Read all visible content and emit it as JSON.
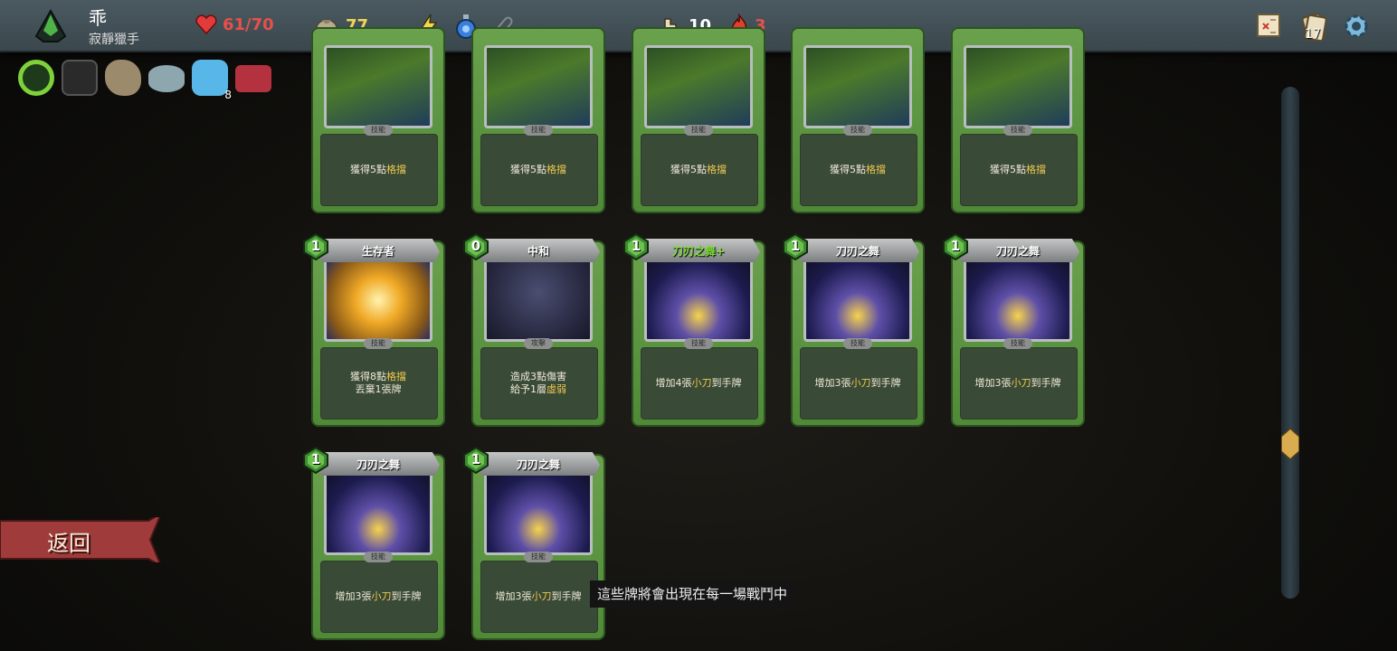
{
  "player": {
    "name": "乖",
    "class": "寂靜獵手"
  },
  "hp": {
    "current": 61,
    "max": 70,
    "text": "61/70"
  },
  "gold": "77",
  "floor": "10",
  "ascension": "3",
  "deck_count": "17",
  "relics": [
    {
      "icon": "ring-of-snake-icon"
    },
    {
      "icon": "dark-box-relic-icon"
    },
    {
      "icon": "pouch-relic-icon"
    },
    {
      "icon": "smooth-stone-relic-icon"
    },
    {
      "icon": "potion-bottle-relic-icon",
      "count": "8"
    },
    {
      "icon": "chest-relic-icon"
    }
  ],
  "cards_top": [
    {
      "desc_pre": "獲得5點",
      "desc_kw": "格擋",
      "type": "技能"
    },
    {
      "desc_pre": "獲得5點",
      "desc_kw": "格擋",
      "type": "技能"
    },
    {
      "desc_pre": "獲得5點",
      "desc_kw": "格擋",
      "type": "技能"
    },
    {
      "desc_pre": "獲得5點",
      "desc_kw": "格擋",
      "type": "技能"
    },
    {
      "desc_pre": "獲得5點",
      "desc_kw": "格擋",
      "type": "技能"
    }
  ],
  "cards": [
    {
      "cost": "1",
      "name": "生存者",
      "type": "技能",
      "line1_pre": "獲得8點",
      "line1_kw": "格擋",
      "line2": "丟棄1張牌"
    },
    {
      "cost": "0",
      "name": "中和",
      "type": "攻擊",
      "line1": "造成3點傷害",
      "line2_pre": "給予1層",
      "line2_kw": "虛弱"
    },
    {
      "cost": "1",
      "name": "刀刃之舞+",
      "type": "技能",
      "desc_pre": "增加4張",
      "desc_kw": "小刀",
      "desc_post": "到手牌"
    },
    {
      "cost": "1",
      "name": "刀刃之舞",
      "type": "技能",
      "desc_pre": "增加3張",
      "desc_kw": "小刀",
      "desc_post": "到手牌"
    },
    {
      "cost": "1",
      "name": "刀刃之舞",
      "type": "技能",
      "desc_pre": "增加3張",
      "desc_kw": "小刀",
      "desc_post": "到手牌"
    },
    {
      "cost": "1",
      "name": "刀刃之舞",
      "type": "技能",
      "desc_pre": "增加3張",
      "desc_kw": "小刀",
      "desc_post": "到手牌"
    },
    {
      "cost": "1",
      "name": "刀刃之舞",
      "type": "技能",
      "desc_pre": "增加3張",
      "desc_kw": "小刀",
      "desc_post": "到手牌"
    }
  ],
  "back_label": "返回",
  "tooltip": "這些牌將會出現在每一場戰鬥中",
  "colors": {
    "hp": "#e8504a",
    "gold": "#f2d35a",
    "keyword": "#efc851",
    "upgraded": "#7fe03a",
    "card_green": "#5b9640"
  }
}
